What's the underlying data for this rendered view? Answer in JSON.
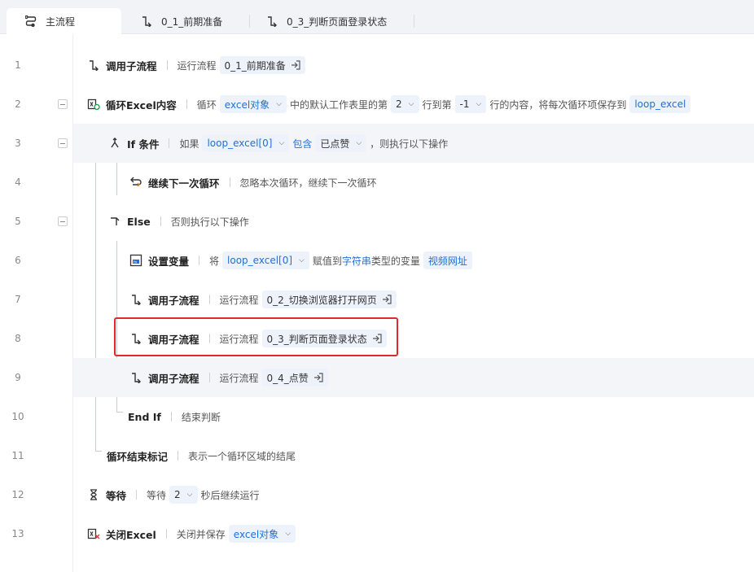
{
  "tabs": [
    {
      "label": "主流程",
      "icon": "flow-icon"
    },
    {
      "label": "0_1_前期准备",
      "icon": "subflow-icon"
    },
    {
      "label": "0_3_判断页面登录状态",
      "icon": "subflow-icon"
    }
  ],
  "rows": {
    "r1": {
      "no": "1",
      "name": "调用子流程",
      "pre": "运行流程",
      "token": "0_1_前期准备"
    },
    "r2": {
      "no": "2",
      "name": "循环Excel内容",
      "t1": "循环",
      "tok1": "excel对象",
      "t2": "中的默认工作表里的第",
      "tok2": "2",
      "t3": "行到第",
      "tok3": "-1",
      "t4": "行的内容，将每次循环项保存到",
      "tok4": "loop_excel"
    },
    "r3": {
      "no": "3",
      "name": "If 条件",
      "t1": "如果",
      "tok1": "loop_excel[0]",
      "op": "包含",
      "tok2": "已点赞",
      "t2": "，则执行以下操作"
    },
    "r4": {
      "no": "4",
      "name": "继续下一次循环",
      "desc": "忽略本次循环，继续下一次循环"
    },
    "r5": {
      "no": "5",
      "name": "Else",
      "desc": "否则执行以下操作"
    },
    "r6": {
      "no": "6",
      "name": "设置变量",
      "t1": "将",
      "tok1": "loop_excel[0]",
      "t2": "赋值到",
      "type": "字符串",
      "t3": "类型的变量",
      "tok2": "视频网址"
    },
    "r7": {
      "no": "7",
      "name": "调用子流程",
      "pre": "运行流程",
      "token": "0_2_切换浏览器打开网页"
    },
    "r8": {
      "no": "8",
      "name": "调用子流程",
      "pre": "运行流程",
      "token": "0_3_判断页面登录状态"
    },
    "r9": {
      "no": "9",
      "name": "调用子流程",
      "pre": "运行流程",
      "token": "0_4_点赞"
    },
    "r10": {
      "no": "10",
      "name": "End If",
      "desc": "结束判断"
    },
    "r11": {
      "no": "11",
      "name": "循环结束标记",
      "desc": "表示一个循环区域的结尾"
    },
    "r12": {
      "no": "12",
      "name": "等待",
      "t1": "等待",
      "tok1": "2",
      "t2": "秒后继续运行"
    },
    "r13": {
      "no": "13",
      "name": "关闭Excel",
      "t1": "关闭并保存",
      "tok1": "excel对象"
    }
  }
}
